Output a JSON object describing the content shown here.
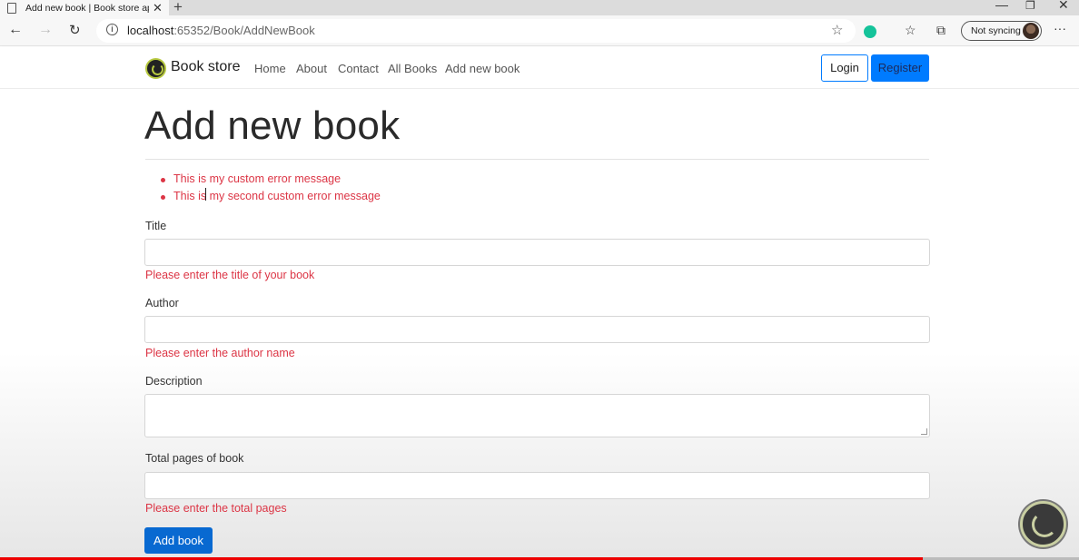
{
  "browser": {
    "tab_title": "Add new book | Book store appli",
    "tab_close": "✕",
    "new_tab": "+",
    "url_host": "localhost",
    "url_rest": ":65352/Book/AddNewBook",
    "sync_label": "Not syncing",
    "icons": [
      "back-icon",
      "forward-icon",
      "refresh-icon",
      "info-icon",
      "star-icon",
      "grammarly-icon",
      "favorites-icon",
      "collections-icon",
      "more-icon"
    ]
  },
  "site": {
    "brand": "Book store",
    "nav": [
      "Home",
      "About",
      "Contact",
      "All Books",
      "Add new book"
    ],
    "login": "Login",
    "register": "Register"
  },
  "page": {
    "heading": "Add new book",
    "summary_errors": [
      "This is my custom error message",
      "This is my second custom error message"
    ],
    "fields": {
      "title": {
        "label": "Title",
        "value": "",
        "error": "Please enter the title of your book"
      },
      "author": {
        "label": "Author",
        "value": "",
        "error": "Please enter the author name"
      },
      "description": {
        "label": "Description",
        "value": ""
      },
      "total_pages": {
        "label": "Total pages of book",
        "value": "",
        "error": "Please enter the total pages"
      }
    },
    "submit": "Add book"
  },
  "video": {
    "progress": 0.855
  },
  "colors": {
    "primary": "#007bff",
    "error": "#dc3545",
    "progress": "#ee0000"
  }
}
